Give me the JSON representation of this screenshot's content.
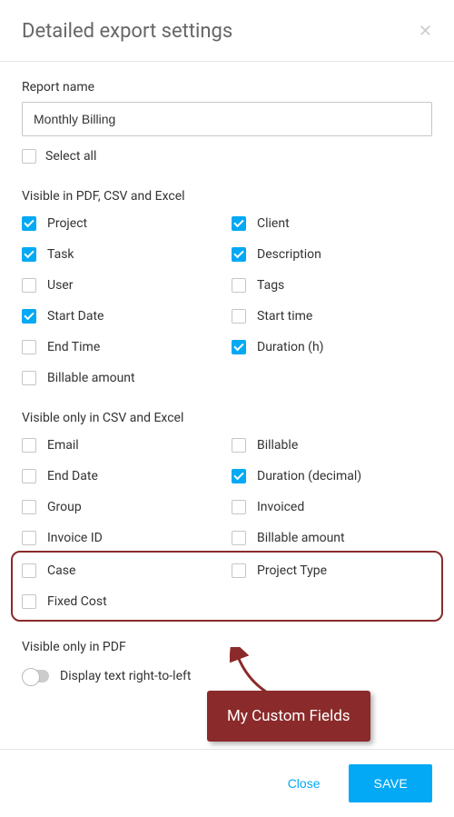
{
  "dialog": {
    "title": "Detailed export settings"
  },
  "report": {
    "label": "Report name",
    "value": "Monthly Billing"
  },
  "selectAll": {
    "label": "Select all",
    "checked": false
  },
  "sections": {
    "pdf_csv_excel": {
      "label": "Visible in PDF, CSV and Excel"
    },
    "csv_excel": {
      "label": "Visible only in CSV and Excel"
    },
    "pdf_only": {
      "label": "Visible only in PDF"
    }
  },
  "fields_all": {
    "project": {
      "label": "Project",
      "checked": true
    },
    "client": {
      "label": "Client",
      "checked": true
    },
    "task": {
      "label": "Task",
      "checked": true
    },
    "description": {
      "label": "Description",
      "checked": true
    },
    "user": {
      "label": "User",
      "checked": false
    },
    "tags": {
      "label": "Tags",
      "checked": false
    },
    "start_date": {
      "label": "Start Date",
      "checked": true
    },
    "start_time": {
      "label": "Start time",
      "checked": false
    },
    "end_time": {
      "label": "End Time",
      "checked": false
    },
    "duration_h": {
      "label": "Duration (h)",
      "checked": true
    },
    "billable_amount": {
      "label": "Billable amount",
      "checked": false
    }
  },
  "fields_csv": {
    "email": {
      "label": "Email",
      "checked": false
    },
    "billable": {
      "label": "Billable",
      "checked": false
    },
    "end_date": {
      "label": "End Date",
      "checked": false
    },
    "duration_decimal": {
      "label": "Duration (decimal)",
      "checked": true
    },
    "group": {
      "label": "Group",
      "checked": false
    },
    "invoiced": {
      "label": "Invoiced",
      "checked": false
    },
    "invoice_id": {
      "label": "Invoice ID",
      "checked": false
    },
    "billable_amount2": {
      "label": "Billable amount",
      "checked": false
    },
    "case": {
      "label": "Case",
      "checked": false
    },
    "project_type": {
      "label": "Project Type",
      "checked": false
    },
    "fixed_cost": {
      "label": "Fixed Cost",
      "checked": false
    }
  },
  "pdf_toggle": {
    "label": "Display text right-to-left",
    "on": false
  },
  "buttons": {
    "close": "Close",
    "save": "SAVE"
  },
  "annotation": {
    "text": "My Custom Fields"
  }
}
